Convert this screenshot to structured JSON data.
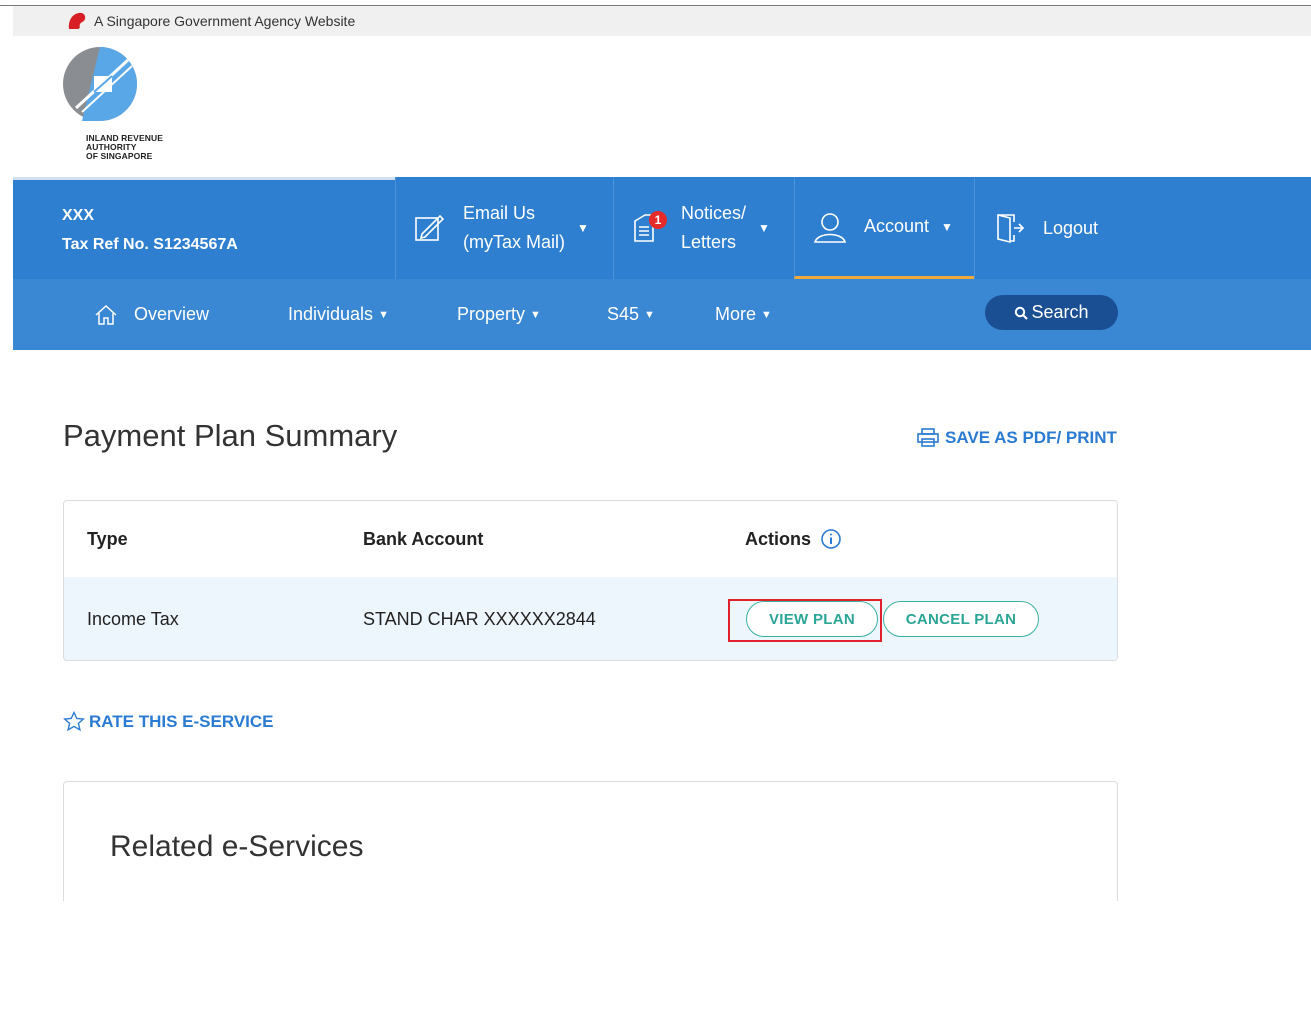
{
  "gov_banner": {
    "text": "A Singapore Government Agency Website"
  },
  "logo": {
    "line1": "INLAND REVENUE",
    "line2": "AUTHORITY",
    "line3": "OF SINGAPORE"
  },
  "header": {
    "user_name": "XXX",
    "tax_ref": "Tax Ref No.  S1234567A",
    "email": {
      "line1": "Email Us",
      "line2": "(myTax Mail)"
    },
    "notices": {
      "line1": "Notices/",
      "line2": "Letters",
      "badge": "1"
    },
    "account": "Account",
    "logout": "Logout"
  },
  "nav": {
    "overview": "Overview",
    "individuals": "Individuals",
    "property": "Property",
    "s45": "S45",
    "more": "More",
    "search": "Search"
  },
  "main": {
    "title": "Payment Plan Summary",
    "print_label": "SAVE AS PDF/ PRINT",
    "table": {
      "headers": {
        "type": "Type",
        "bank": "Bank Account",
        "actions": "Actions"
      },
      "rows": [
        {
          "type": "Income Tax",
          "bank": "STAND CHAR XXXXXX2844",
          "view": "VIEW PLAN",
          "cancel": "CANCEL PLAN"
        }
      ]
    },
    "rate_label": "RATE THIS E-SERVICE",
    "related_title": "Related e-Services"
  },
  "colors": {
    "header_bg": "#2f7fd0",
    "nav_bg": "#3a87d4",
    "search_bg": "#1b4f93",
    "link_blue": "#2a7bd1",
    "teal": "#2ba596",
    "active_underline": "#f0a93b",
    "highlight_red": "#e0202a"
  }
}
